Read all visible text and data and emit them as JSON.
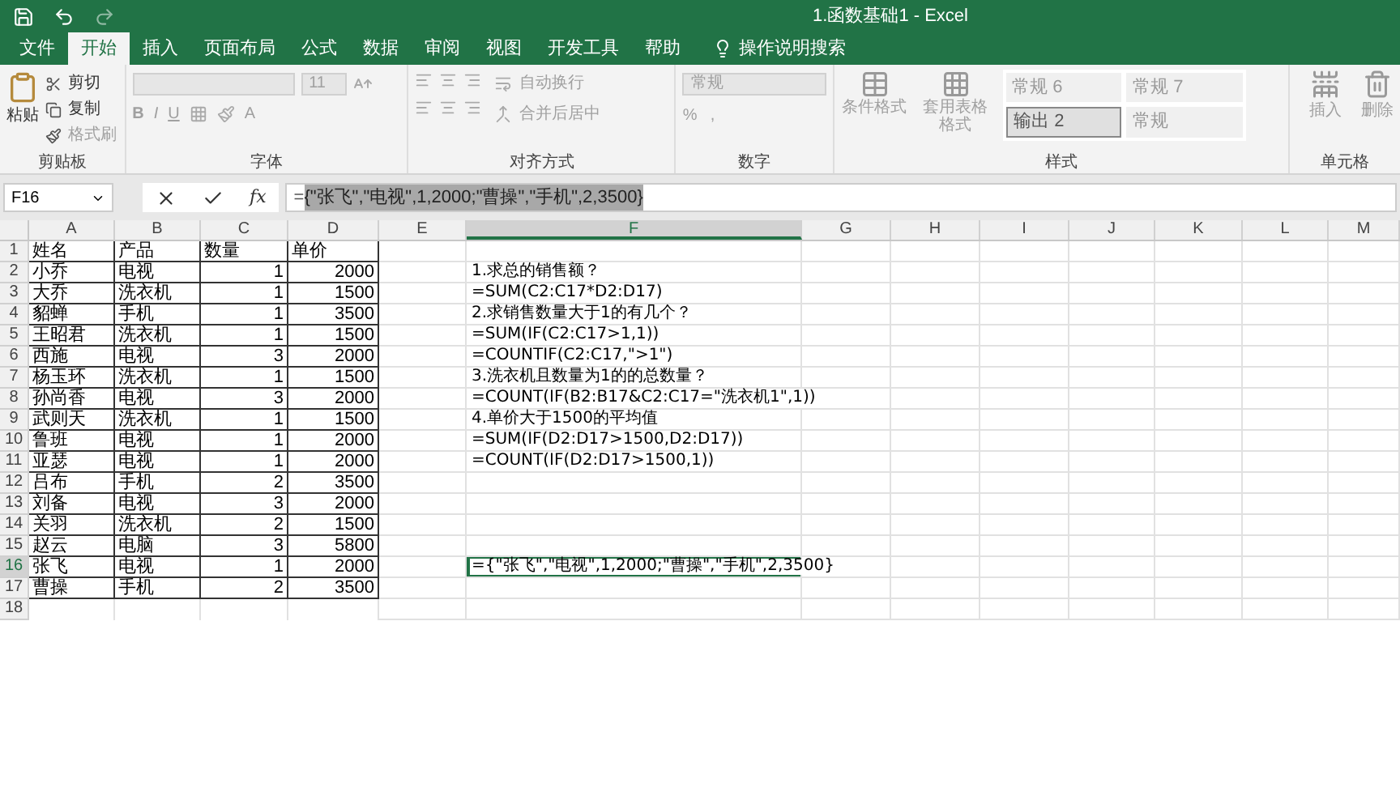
{
  "window": {
    "title": "1.函数基础1  -  Excel"
  },
  "ribbon_tabs": [
    {
      "label": "文件",
      "selected": false
    },
    {
      "label": "开始",
      "selected": true
    },
    {
      "label": "插入",
      "selected": false
    },
    {
      "label": "页面布局",
      "selected": false
    },
    {
      "label": "公式",
      "selected": false
    },
    {
      "label": "数据",
      "selected": false
    },
    {
      "label": "审阅",
      "selected": false
    },
    {
      "label": "视图",
      "selected": false
    },
    {
      "label": "开发工具",
      "selected": false
    },
    {
      "label": "帮助",
      "selected": false
    }
  ],
  "tell_me": {
    "label": "操作说明搜索"
  },
  "ribbon": {
    "disabled": true,
    "clipboard": {
      "label": "剪贴板",
      "paste": "粘贴",
      "items": [
        "剪切",
        "复制",
        "格式刷"
      ]
    },
    "font": {
      "label": "字体",
      "size": "11",
      "buttons": [
        "B",
        "I",
        "U"
      ],
      "color_letter": "A"
    },
    "alignment": {
      "label": "对齐方式",
      "items": [
        "自动换行",
        "合并后居中"
      ]
    },
    "number": {
      "label": "数字",
      "format": "常规",
      "symbols": [
        "%",
        ","
      ]
    },
    "styles": {
      "label": "样式",
      "commands": [
        "条件格式",
        "套用表格格式"
      ],
      "presets": [
        {
          "label": "常规 6",
          "selected": false
        },
        {
          "label": "常规 7",
          "selected": false
        },
        {
          "label": "输出 2",
          "selected": true
        },
        {
          "label": "常规",
          "selected": false
        }
      ]
    },
    "cells": {
      "label": "单元格",
      "items": [
        "插入",
        "删除"
      ]
    }
  },
  "formula_bar": {
    "name_box": "F16",
    "fx": "fx",
    "prefix": "=",
    "selection": "{\"张飞\",\"电视\",1,2000;\"曹操\",\"手机\",2,3500}"
  },
  "columns": [
    {
      "label": "A",
      "selected": false
    },
    {
      "label": "B",
      "selected": false
    },
    {
      "label": "C",
      "selected": false
    },
    {
      "label": "D",
      "selected": false
    },
    {
      "label": "E",
      "selected": false
    },
    {
      "label": "F",
      "selected": true
    },
    {
      "label": "G",
      "selected": false
    },
    {
      "label": "H",
      "selected": false
    },
    {
      "label": "I",
      "selected": false
    },
    {
      "label": "J",
      "selected": false
    },
    {
      "label": "K",
      "selected": false
    },
    {
      "label": "L",
      "selected": false
    },
    {
      "label": "M",
      "selected": false
    }
  ],
  "rows": [
    {
      "number": "1",
      "selected": false,
      "cells": {
        "A": "姓名",
        "B": "产品",
        "C": "数量",
        "D": "单价"
      }
    },
    {
      "number": "2",
      "selected": false,
      "cells": {
        "A": "小乔",
        "B": "电视",
        "C": "1",
        "D": "2000",
        "F": "1.求总的销售额？"
      }
    },
    {
      "number": "3",
      "selected": false,
      "cells": {
        "A": "大乔",
        "B": "洗衣机",
        "C": "1",
        "D": "1500",
        "F": "=SUM(C2:C17*D2:D17)"
      }
    },
    {
      "number": "4",
      "selected": false,
      "cells": {
        "A": "貂蝉",
        "B": "手机",
        "C": "1",
        "D": "3500",
        "F": "2.求销售数量大于1的有几个？"
      }
    },
    {
      "number": "5",
      "selected": false,
      "cells": {
        "A": "王昭君",
        "B": "洗衣机",
        "C": "1",
        "D": "1500",
        "F": "=SUM(IF(C2:C17>1,1))"
      }
    },
    {
      "number": "6",
      "selected": false,
      "cells": {
        "A": "西施",
        "B": "电视",
        "C": "3",
        "D": "2000",
        "F": "=COUNTIF(C2:C17,\">1\")"
      }
    },
    {
      "number": "7",
      "selected": false,
      "cells": {
        "A": "杨玉环",
        "B": "洗衣机",
        "C": "1",
        "D": "1500",
        "F": "3.洗衣机且数量为1的的总数量？"
      }
    },
    {
      "number": "8",
      "selected": false,
      "cells": {
        "A": "孙尚香",
        "B": "电视",
        "C": "3",
        "D": "2000",
        "F": "=COUNT(IF(B2:B17&C2:C17=\"洗衣机1\",1))"
      }
    },
    {
      "number": "9",
      "selected": false,
      "cells": {
        "A": "武则天",
        "B": "洗衣机",
        "C": "1",
        "D": "1500",
        "F": "4.单价大于1500的平均值"
      }
    },
    {
      "number": "10",
      "selected": false,
      "cells": {
        "A": "鲁班",
        "B": "电视",
        "C": "1",
        "D": "2000",
        "F": "=SUM(IF(D2:D17>1500,D2:D17))"
      }
    },
    {
      "number": "11",
      "selected": false,
      "cells": {
        "A": "亚瑟",
        "B": "电视",
        "C": "1",
        "D": "2000",
        "F": "=COUNT(IF(D2:D17>1500,1))"
      }
    },
    {
      "number": "12",
      "selected": false,
      "cells": {
        "A": "吕布",
        "B": "手机",
        "C": "2",
        "D": "3500"
      }
    },
    {
      "number": "13",
      "selected": false,
      "cells": {
        "A": "刘备",
        "B": "电视",
        "C": "3",
        "D": "2000"
      }
    },
    {
      "number": "14",
      "selected": false,
      "cells": {
        "A": "关羽",
        "B": "洗衣机",
        "C": "2",
        "D": "1500"
      }
    },
    {
      "number": "15",
      "selected": false,
      "cells": {
        "A": "赵云",
        "B": "电脑",
        "C": "3",
        "D": "5800"
      }
    },
    {
      "number": "16",
      "selected": true,
      "cells": {
        "A": "张飞",
        "B": "电视",
        "C": "1",
        "D": "2000",
        "F": "={\"张飞\",\"电视\",1,2000;\"曹操\",\"手机\",2,3500}"
      }
    },
    {
      "number": "17",
      "selected": false,
      "cells": {
        "A": "曹操",
        "B": "手机",
        "C": "2",
        "D": "3500"
      }
    },
    {
      "number": "18",
      "selected": false,
      "cells": {}
    }
  ]
}
